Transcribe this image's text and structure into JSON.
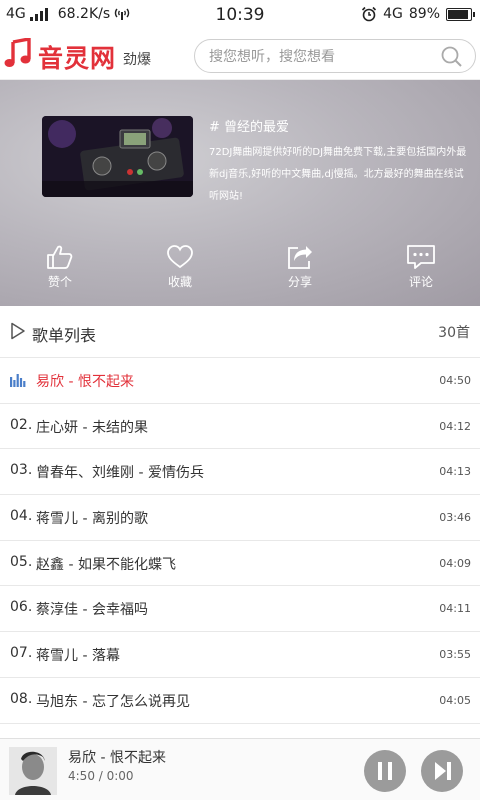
{
  "status_bar": {
    "network": "4G",
    "speed": "68.2K/s",
    "time": "10:39",
    "network_right": "4G",
    "battery": "89%",
    "battery_level": 0.89
  },
  "header": {
    "logo": "音灵网",
    "subtitle": "劲爆",
    "search_placeholder": "搜您想听，搜您想看"
  },
  "banner": {
    "title": "# 曾经的最爱",
    "description": "72DJ舞曲网提供好听的DJ舞曲免费下载,主要包括国内外最新dj音乐,好听的中文舞曲,dj慢摇。北方最好的舞曲在线试听网站!",
    "actions": [
      {
        "label": "赞个",
        "icon": "thumbs-up-icon"
      },
      {
        "label": "收藏",
        "icon": "heart-icon"
      },
      {
        "label": "分享",
        "icon": "share-icon"
      },
      {
        "label": "评论",
        "icon": "comment-icon"
      }
    ]
  },
  "list": {
    "title": "歌单列表",
    "count": "30首",
    "songs": [
      {
        "num": "",
        "name": "易欣 - 恨不起来",
        "time": "04:50",
        "active": true
      },
      {
        "num": "02.",
        "name": "庄心妍 - 未结的果",
        "time": "04:12"
      },
      {
        "num": "03.",
        "name": "曾春年、刘维刚 - 爱情伤兵",
        "time": "04:13"
      },
      {
        "num": "04.",
        "name": "蒋雪儿 - 离别的歌",
        "time": "03:46"
      },
      {
        "num": "05.",
        "name": "赵鑫 - 如果不能化蝶飞",
        "time": "04:09"
      },
      {
        "num": "06.",
        "name": "蔡淳佳 - 会幸福吗",
        "time": "04:11"
      },
      {
        "num": "07.",
        "name": "蒋雪儿 - 落幕",
        "time": "03:55"
      },
      {
        "num": "08.",
        "name": "马旭东 - 忘了怎么说再见",
        "time": "04:05"
      }
    ]
  },
  "player": {
    "title": "易欣 - 恨不起来",
    "time": "4:50 / 0:00"
  },
  "colors": {
    "accent": "#e2313a",
    "banner": "#b9b6bd",
    "button": "#9b9b9b"
  }
}
